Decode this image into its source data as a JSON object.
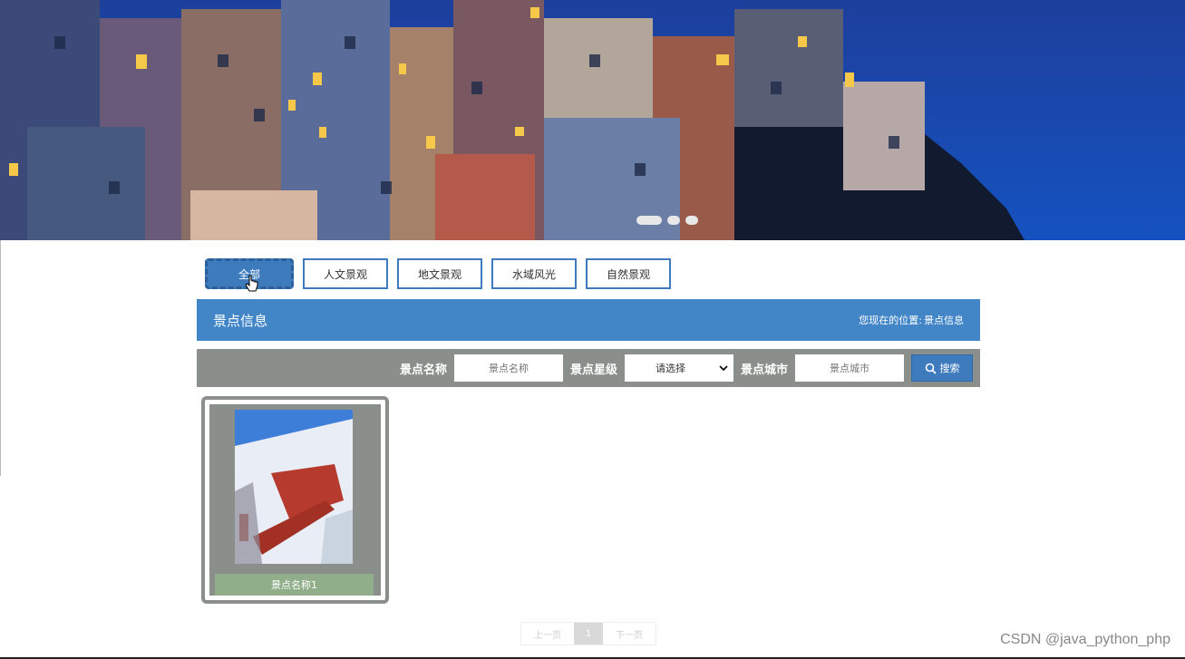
{
  "banner": {
    "slides": [
      {
        "active": true
      },
      {
        "active": false
      },
      {
        "active": false
      }
    ]
  },
  "tabs": [
    {
      "label": "全部",
      "active": true
    },
    {
      "label": "人文景观",
      "active": false
    },
    {
      "label": "地文景观",
      "active": false
    },
    {
      "label": "水域风光",
      "active": false
    },
    {
      "label": "自然景观",
      "active": false
    }
  ],
  "titlebar": {
    "title": "景点信息",
    "location_prefix": "您现在的位置:",
    "location_value": "景点信息"
  },
  "search": {
    "name_label": "景点名称",
    "name_placeholder": "景点名称",
    "level_label": "景点星级",
    "level_selected": "请选择",
    "city_label": "景点城市",
    "city_placeholder": "景点城市",
    "button_label": "搜索"
  },
  "cards": [
    {
      "name": "景点名称1"
    }
  ],
  "pagination": {
    "prev": "上一页",
    "current": "1",
    "next": "下一页"
  },
  "watermark": "CSDN @java_python_php",
  "colors": {
    "primary": "#4286c8",
    "gray": "#8a8f8c",
    "caption": "#8fae89"
  }
}
